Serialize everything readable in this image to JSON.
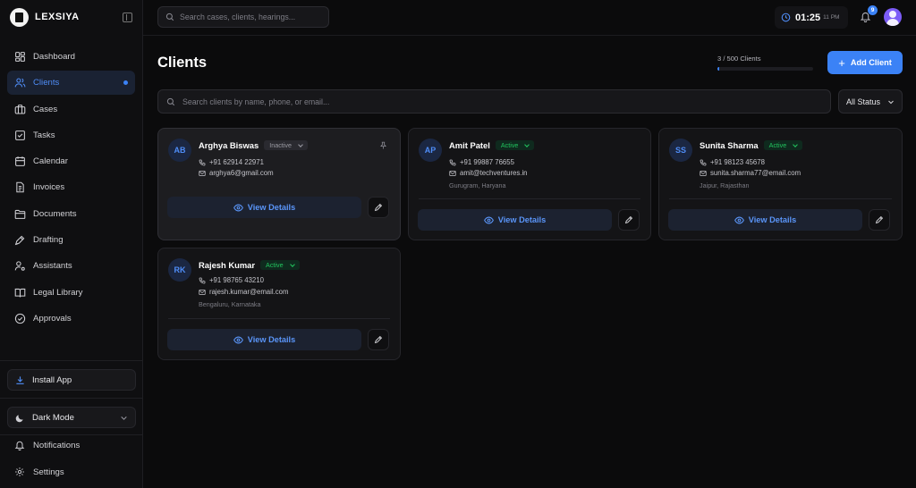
{
  "brand": {
    "name": "LEXSIYA"
  },
  "sidebar": {
    "items": [
      {
        "label": "Dashboard",
        "icon": "dashboard-icon"
      },
      {
        "label": "Clients",
        "icon": "users-icon",
        "active": true
      },
      {
        "label": "Cases",
        "icon": "briefcase-icon"
      },
      {
        "label": "Tasks",
        "icon": "checkbox-icon"
      },
      {
        "label": "Calendar",
        "icon": "calendar-icon"
      },
      {
        "label": "Invoices",
        "icon": "invoice-icon"
      },
      {
        "label": "Documents",
        "icon": "folder-icon"
      },
      {
        "label": "Drafting",
        "icon": "pen-icon"
      },
      {
        "label": "Assistants",
        "icon": "user-gear-icon"
      },
      {
        "label": "Legal Library",
        "icon": "book-icon"
      },
      {
        "label": "Approvals",
        "icon": "check-circle-icon"
      }
    ],
    "install_label": "Install App",
    "theme_label": "Dark Mode",
    "notifications_label": "Notifications",
    "settings_label": "Settings"
  },
  "topbar": {
    "search_placeholder": "Search cases, clients, hearings...",
    "time": "01:25",
    "ampm": "11 PM",
    "notification_count": "9"
  },
  "page": {
    "title": "Clients",
    "quota_text": "3 / 500 Clients",
    "quota_fraction": 0.006,
    "add_button": "Add Client",
    "search_placeholder": "Search clients by name, phone, or email...",
    "status_filter": "All Status"
  },
  "clients": [
    {
      "initials": "AB",
      "name": "Arghya Biswas",
      "status": "Inactive",
      "phone": "+91 62914 22971",
      "email": "arghya6@gmail.com",
      "location": "",
      "view_label": "View Details"
    },
    {
      "initials": "AP",
      "name": "Amit Patel",
      "status": "Active",
      "phone": "+91 99887 76655",
      "email": "amit@techventures.in",
      "location": "Gurugram, Haryana",
      "view_label": "View Details"
    },
    {
      "initials": "SS",
      "name": "Sunita Sharma",
      "status": "Active",
      "phone": "+91 98123 45678",
      "email": "sunita.sharma77@email.com",
      "location": "Jaipur, Rajasthan",
      "view_label": "View Details"
    },
    {
      "initials": "RK",
      "name": "Rajesh Kumar",
      "status": "Active",
      "phone": "+91 98765 43210",
      "email": "rajesh.kumar@email.com",
      "location": "Bengaluru, Karnataka",
      "view_label": "View Details"
    }
  ],
  "colors": {
    "accent": "#3b82f6",
    "active": "#22c55e",
    "background": "#0b0b0c"
  }
}
